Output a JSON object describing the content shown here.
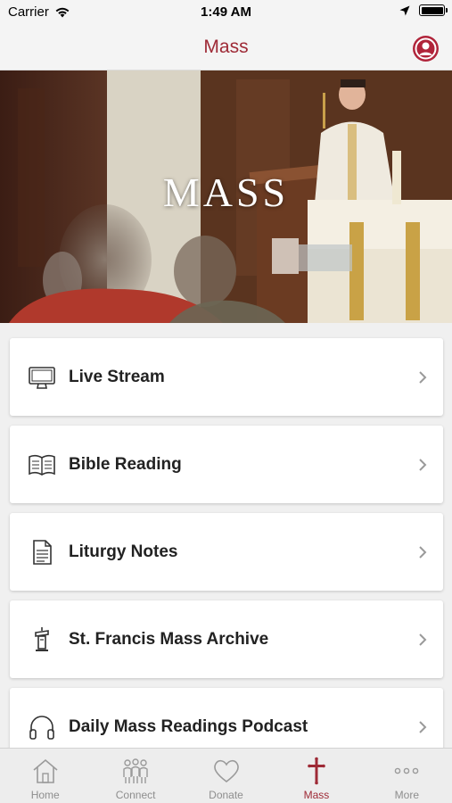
{
  "status_bar": {
    "carrier": "Carrier",
    "time": "1:49 AM"
  },
  "nav": {
    "title": "Mass"
  },
  "hero": {
    "title": "MASS"
  },
  "menu": [
    {
      "label": "Live Stream",
      "icon": "monitor-icon"
    },
    {
      "label": "Bible Reading",
      "icon": "book-icon"
    },
    {
      "label": "Liturgy Notes",
      "icon": "document-icon"
    },
    {
      "label": "St. Francis Mass Archive",
      "icon": "lectern-icon"
    },
    {
      "label": "Daily Mass Readings Podcast",
      "icon": "headphones-icon"
    }
  ],
  "tabs": [
    {
      "label": "Home",
      "icon": "home-icon"
    },
    {
      "label": "Connect",
      "icon": "people-icon"
    },
    {
      "label": "Donate",
      "icon": "heart-icon"
    },
    {
      "label": "Mass",
      "icon": "cross-icon"
    },
    {
      "label": "More",
      "icon": "more-icon"
    }
  ],
  "colors": {
    "accent": "#9e2a36",
    "inactive": "#8e8e8e"
  }
}
